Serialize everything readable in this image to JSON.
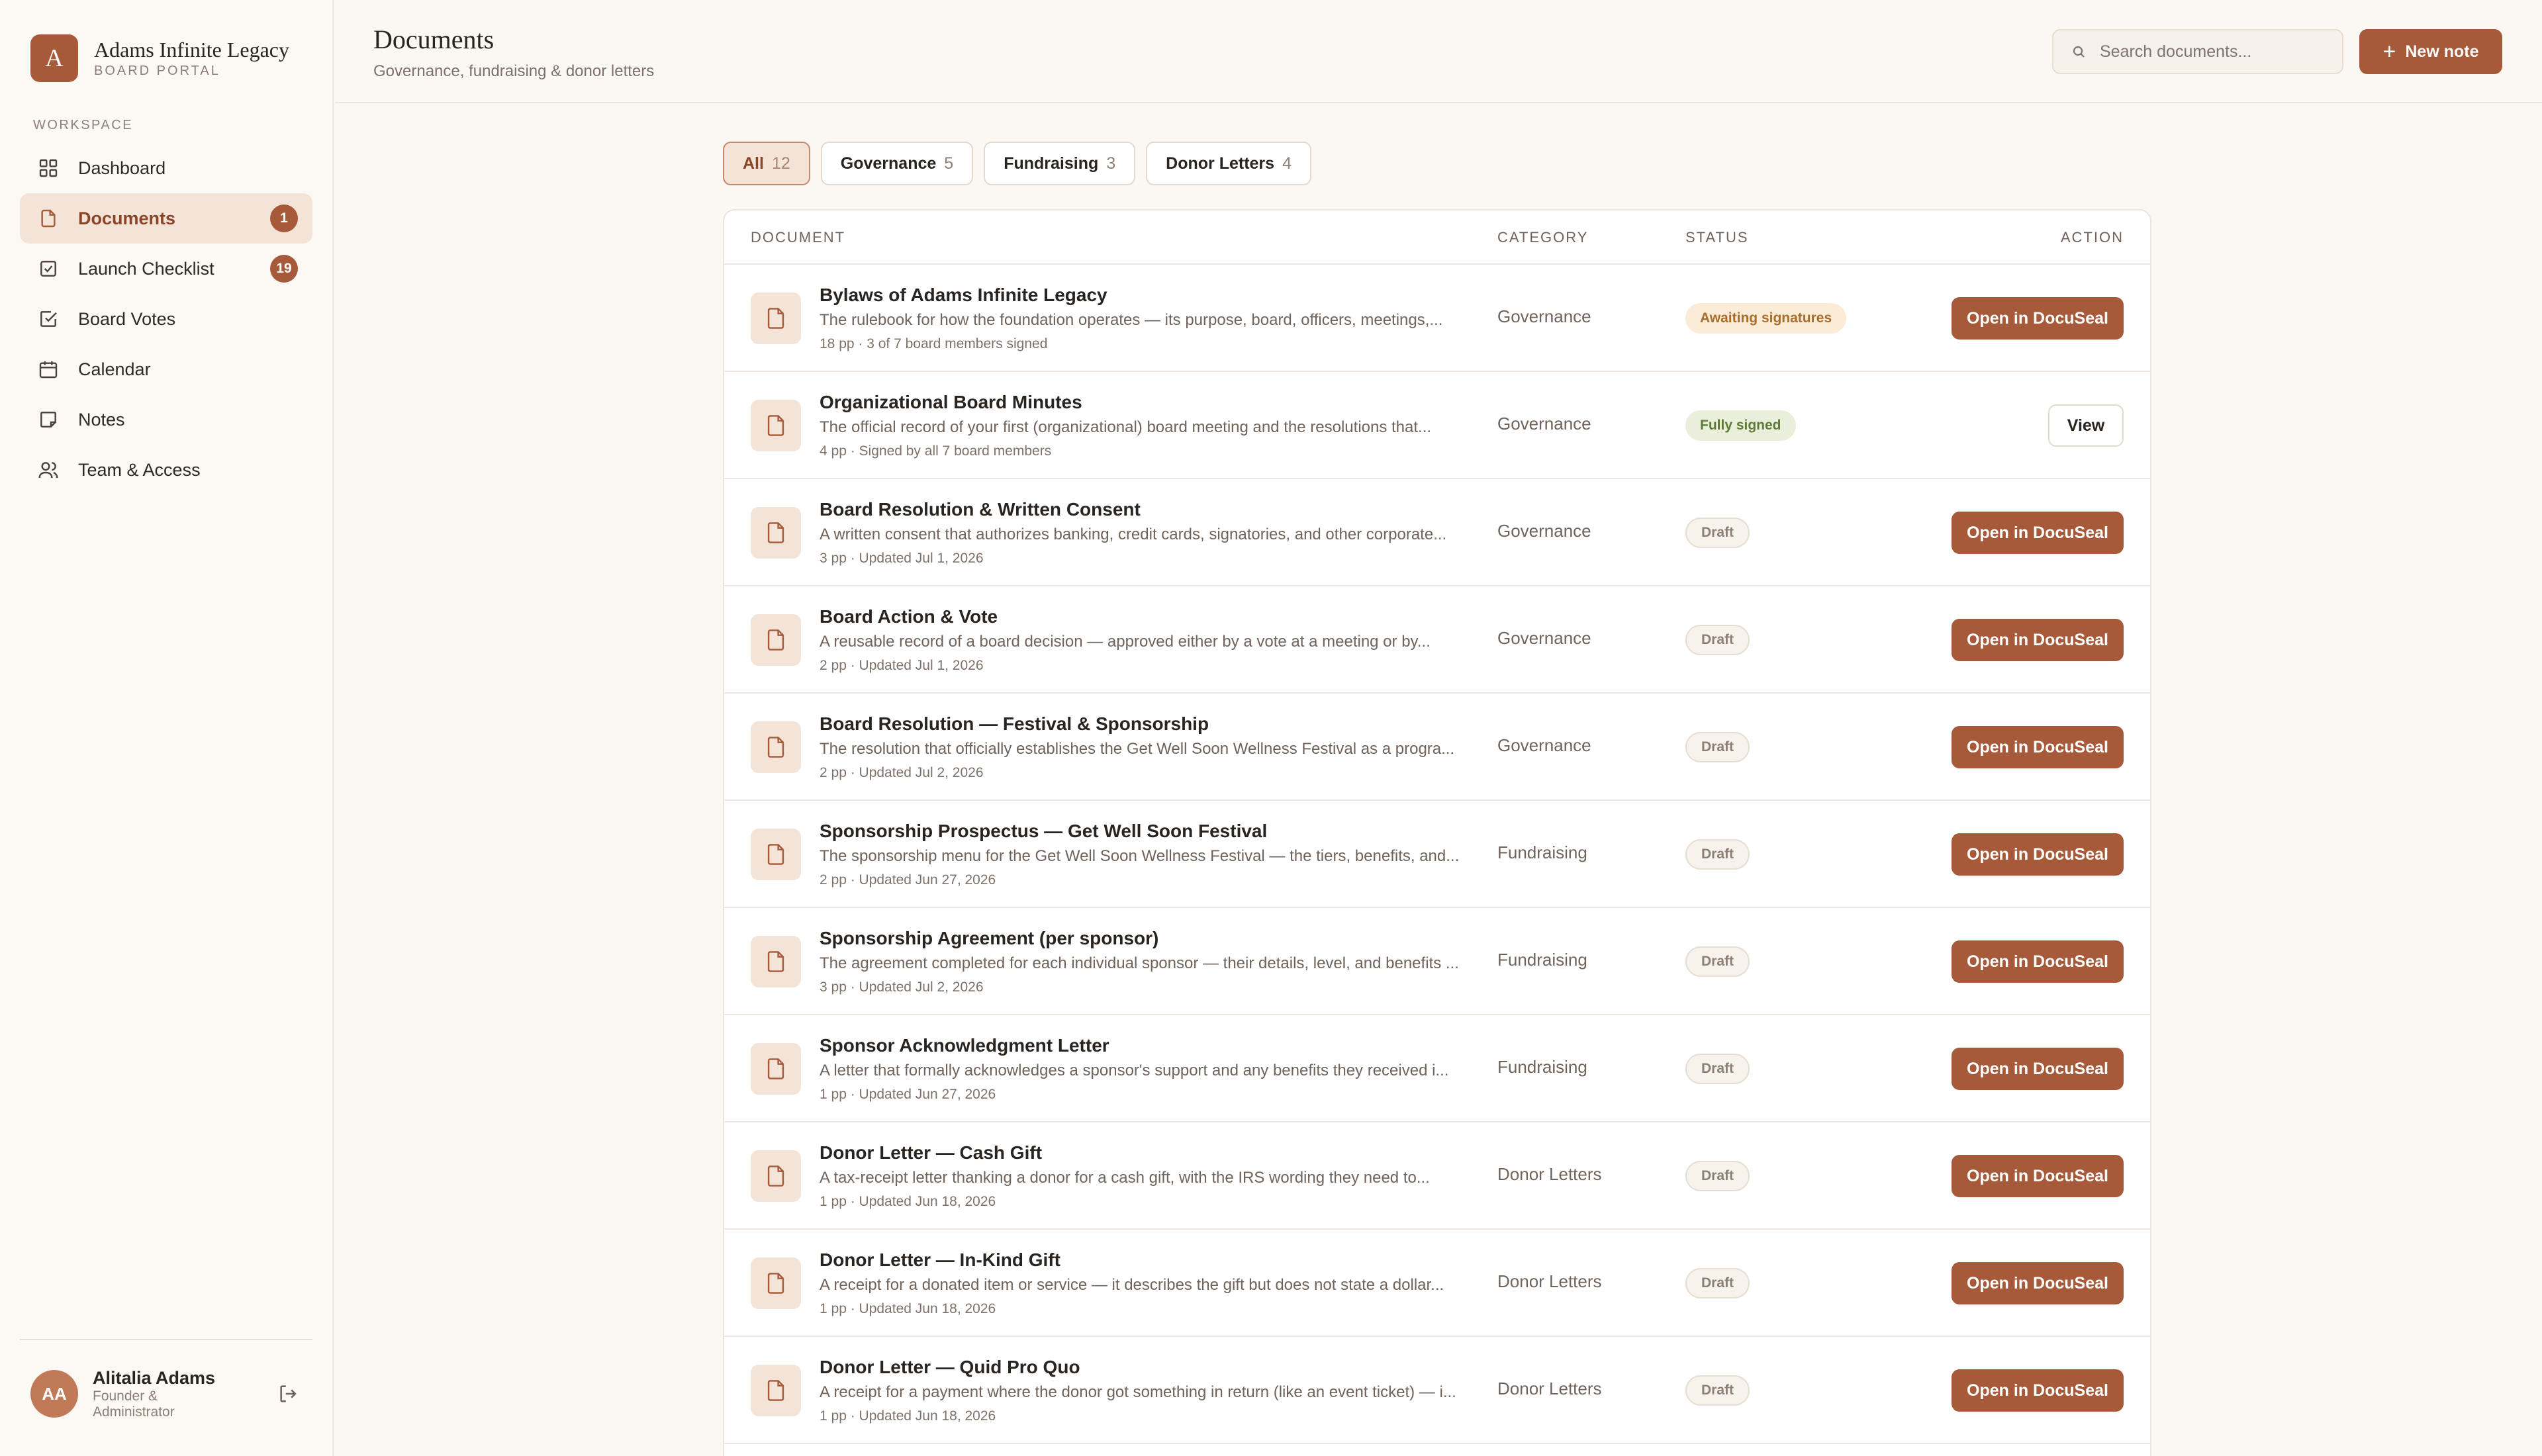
{
  "brand": {
    "initial": "A",
    "name": "Adams Infinite Legacy",
    "subtitle": "BOARD PORTAL"
  },
  "sidebar": {
    "section_label": "WORKSPACE",
    "items": [
      {
        "label": "Dashboard",
        "icon": "grid-icon",
        "badge": ""
      },
      {
        "label": "Documents",
        "icon": "document-icon",
        "badge": "1",
        "active": true
      },
      {
        "label": "Launch Checklist",
        "icon": "checklist-icon",
        "badge": "19"
      },
      {
        "label": "Board Votes",
        "icon": "vote-check-icon",
        "badge": ""
      },
      {
        "label": "Calendar",
        "icon": "calendar-icon",
        "badge": ""
      },
      {
        "label": "Notes",
        "icon": "note-icon",
        "badge": ""
      },
      {
        "label": "Team & Access",
        "icon": "users-icon",
        "badge": ""
      }
    ]
  },
  "user": {
    "initials": "AA",
    "name": "Alitalia Adams",
    "role": "Founder & Administrator"
  },
  "header": {
    "title": "Documents",
    "subtitle": "Governance, fundraising & donor letters",
    "search_placeholder": "Search documents...",
    "new_note_label": "New note"
  },
  "filters": [
    {
      "label": "All",
      "count": "12",
      "active": true
    },
    {
      "label": "Governance",
      "count": "5"
    },
    {
      "label": "Fundraising",
      "count": "3"
    },
    {
      "label": "Donor Letters",
      "count": "4"
    }
  ],
  "table": {
    "columns": {
      "document": "DOCUMENT",
      "category": "CATEGORY",
      "status": "STATUS",
      "action": "ACTION"
    },
    "rows": [
      {
        "title": "Bylaws of Adams Infinite Legacy",
        "desc": "The rulebook for how the foundation operates — its purpose, board, officers, meetings,...",
        "meta": "18 pp · 3 of 7 board members signed",
        "category": "Governance",
        "status": "Awaiting signatures",
        "status_kind": "awaiting",
        "action": "Open in DocuSeal",
        "action_kind": "primary"
      },
      {
        "title": "Organizational Board Minutes",
        "desc": "The official record of your first (organizational) board meeting and the resolutions that...",
        "meta": "4 pp · Signed by all 7 board members",
        "category": "Governance",
        "status": "Fully signed",
        "status_kind": "signed",
        "action": "View",
        "action_kind": "secondary"
      },
      {
        "title": "Board Resolution & Written Consent",
        "desc": "A written consent that authorizes banking, credit cards, signatories, and other corporate...",
        "meta": "3 pp · Updated Jul 1, 2026",
        "category": "Governance",
        "status": "Draft",
        "status_kind": "draft",
        "action": "Open in DocuSeal",
        "action_kind": "primary"
      },
      {
        "title": "Board Action & Vote",
        "desc": "A reusable record of a board decision — approved either by a vote at a meeting or by...",
        "meta": "2 pp · Updated Jul 1, 2026",
        "category": "Governance",
        "status": "Draft",
        "status_kind": "draft",
        "action": "Open in DocuSeal",
        "action_kind": "primary"
      },
      {
        "title": "Board Resolution — Festival & Sponsorship",
        "desc": "The resolution that officially establishes the Get Well Soon Wellness Festival as a progra...",
        "meta": "2 pp · Updated Jul 2, 2026",
        "category": "Governance",
        "status": "Draft",
        "status_kind": "draft",
        "action": "Open in DocuSeal",
        "action_kind": "primary"
      },
      {
        "title": "Sponsorship Prospectus — Get Well Soon Festival",
        "desc": "The sponsorship menu for the Get Well Soon Wellness Festival — the tiers, benefits, and...",
        "meta": "2 pp · Updated Jun 27, 2026",
        "category": "Fundraising",
        "status": "Draft",
        "status_kind": "draft",
        "action": "Open in DocuSeal",
        "action_kind": "primary"
      },
      {
        "title": "Sponsorship Agreement (per sponsor)",
        "desc": "The agreement completed for each individual sponsor — their details, level, and benefits ...",
        "meta": "3 pp · Updated Jul 2, 2026",
        "category": "Fundraising",
        "status": "Draft",
        "status_kind": "draft",
        "action": "Open in DocuSeal",
        "action_kind": "primary"
      },
      {
        "title": "Sponsor Acknowledgment Letter",
        "desc": "A letter that formally acknowledges a sponsor's support and any benefits they received i...",
        "meta": "1 pp · Updated Jun 27, 2026",
        "category": "Fundraising",
        "status": "Draft",
        "status_kind": "draft",
        "action": "Open in DocuSeal",
        "action_kind": "primary"
      },
      {
        "title": "Donor Letter — Cash Gift",
        "desc": "A tax-receipt letter thanking a donor for a cash gift, with the IRS wording they need to...",
        "meta": "1 pp · Updated Jun 18, 2026",
        "category": "Donor Letters",
        "status": "Draft",
        "status_kind": "draft",
        "action": "Open in DocuSeal",
        "action_kind": "primary"
      },
      {
        "title": "Donor Letter — In-Kind Gift",
        "desc": "A receipt for a donated item or service — it describes the gift but does not state a dollar...",
        "meta": "1 pp · Updated Jun 18, 2026",
        "category": "Donor Letters",
        "status": "Draft",
        "status_kind": "draft",
        "action": "Open in DocuSeal",
        "action_kind": "primary"
      },
      {
        "title": "Donor Letter — Quid Pro Quo",
        "desc": "A receipt for a payment where the donor got something in return (like an event ticket) — i...",
        "meta": "1 pp · Updated Jun 18, 2026",
        "category": "Donor Letters",
        "status": "Draft",
        "status_kind": "draft",
        "action": "Open in DocuSeal",
        "action_kind": "primary"
      }
    ]
  }
}
